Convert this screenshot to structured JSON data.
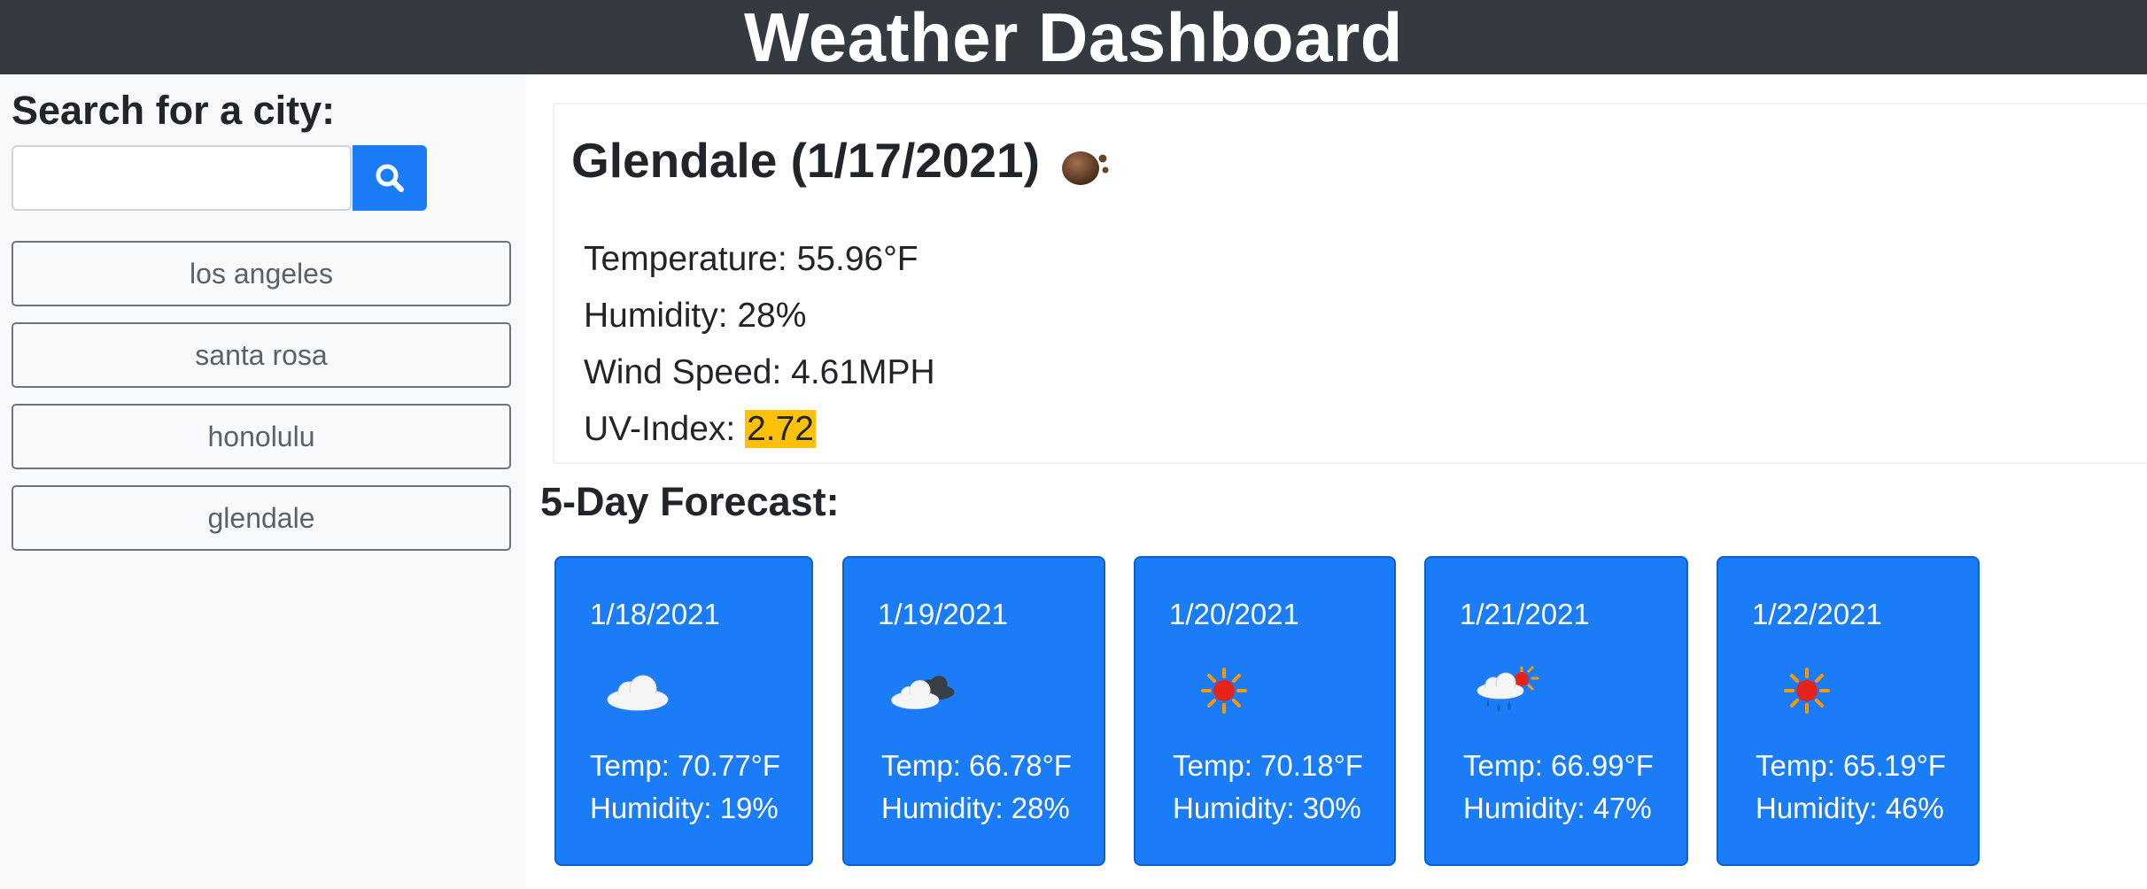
{
  "app": {
    "title": "Weather Dashboard"
  },
  "search": {
    "label": "Search for a city:",
    "value": "",
    "placeholder": "",
    "button_icon": "search-icon"
  },
  "history": [
    {
      "label": "los angeles"
    },
    {
      "label": "santa rosa"
    },
    {
      "label": "honolulu"
    },
    {
      "label": "glendale"
    }
  ],
  "current": {
    "city_date": "Glendale (1/17/2021)",
    "icon": "haze-icon",
    "temperature": "Temperature: 55.96°F",
    "humidity": "Humidity: 28%",
    "wind": "Wind Speed: 4.61MPH",
    "uv_label": "UV-Index: ",
    "uv_value": "2.72",
    "uv_color": "#ffc107"
  },
  "forecast": {
    "heading": "5-Day Forecast:",
    "days": [
      {
        "date": "1/18/2021",
        "icon": "cloud-icon",
        "temp": "Temp: 70.77°F",
        "humidity": "Humidity: 19%"
      },
      {
        "date": "1/19/2021",
        "icon": "broken-clouds-icon",
        "temp": "Temp: 66.78°F",
        "humidity": "Humidity: 28%"
      },
      {
        "date": "1/20/2021",
        "icon": "sun-icon",
        "temp": "Temp: 70.18°F",
        "humidity": "Humidity: 30%"
      },
      {
        "date": "1/21/2021",
        "icon": "rain-sun-icon",
        "temp": "Temp: 66.99°F",
        "humidity": "Humidity: 47%"
      },
      {
        "date": "1/22/2021",
        "icon": "sun-icon",
        "temp": "Temp: 65.19°F",
        "humidity": "Humidity: 46%"
      }
    ]
  },
  "colors": {
    "header_bg": "#343a40",
    "primary": "#1a7cf7",
    "sidebar_bg": "#f8f9fa",
    "uv_highlight": "#ffc107"
  }
}
